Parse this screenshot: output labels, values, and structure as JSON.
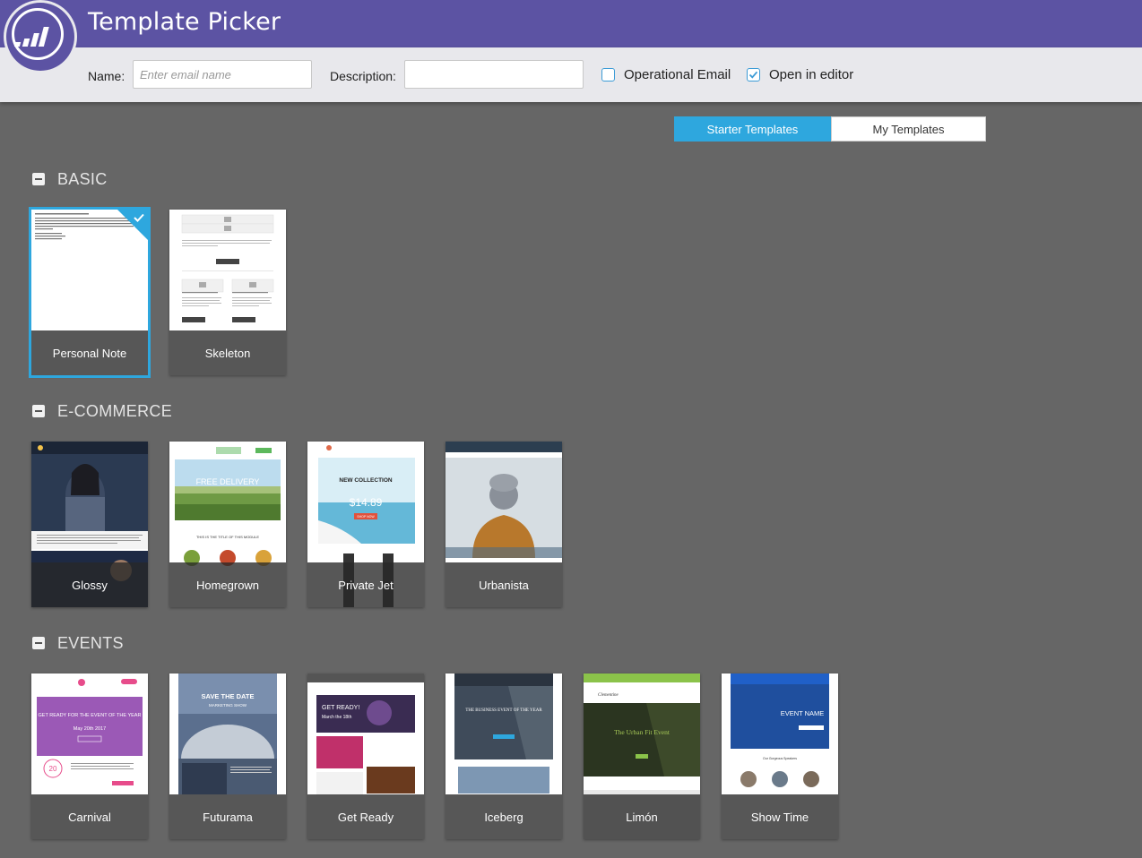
{
  "app": {
    "title": "Template Picker"
  },
  "form": {
    "name_label": "Name:",
    "name_placeholder": "Enter email name",
    "name_value": "",
    "description_label": "Description:",
    "description_value": "",
    "operational_email": {
      "label": "Operational Email",
      "checked": false
    },
    "open_in_editor": {
      "label": "Open in editor",
      "checked": true
    }
  },
  "tabs": [
    {
      "label": "Starter Templates",
      "active": true
    },
    {
      "label": "My Templates",
      "active": false
    }
  ],
  "sections": [
    {
      "title": "BASIC",
      "templates": [
        {
          "name": "Personal Note",
          "selected": true
        },
        {
          "name": "Skeleton",
          "selected": false
        }
      ]
    },
    {
      "title": "E-COMMERCE",
      "templates": [
        {
          "name": "Glossy"
        },
        {
          "name": "Homegrown"
        },
        {
          "name": "Private Jet"
        },
        {
          "name": "Urbanista"
        }
      ]
    },
    {
      "title": "EVENTS",
      "templates": [
        {
          "name": "Carnival"
        },
        {
          "name": "Futurama"
        },
        {
          "name": "Get Ready"
        },
        {
          "name": "Iceberg"
        },
        {
          "name": "Limón"
        },
        {
          "name": "Show Time"
        }
      ]
    }
  ],
  "thumb_text": {
    "homegrown": {
      "banner": "FREE DELIVERY",
      "module": "THIS IS THE TITLE OF THIS MODULE"
    },
    "privatejet": {
      "heading": "NEW COLLECTION",
      "price": "$14.89",
      "button": "SHOP NOW"
    },
    "carnival": {
      "headline": "GET READY FOR THE EVENT OF THE YEAR",
      "date": "May 20th 2017",
      "badge": "20"
    },
    "futurama": {
      "headline": "SAVE THE DATE",
      "sub": "MARKETING SHOW"
    },
    "getready": {
      "headline": "GET READY!",
      "sub": "March the 18th"
    },
    "iceberg": {
      "headline": "THE BUSINESS EVENT OF THE YEAR"
    },
    "limon": {
      "logo": "Clementine",
      "headline": "The Urban Fit Event"
    },
    "showtime": {
      "headline": "EVENT NAME",
      "sub": "Our Gorgeous Speakers"
    }
  },
  "colors": {
    "header": "#5c53a3",
    "accent": "#2ea7de",
    "background": "#666666"
  }
}
